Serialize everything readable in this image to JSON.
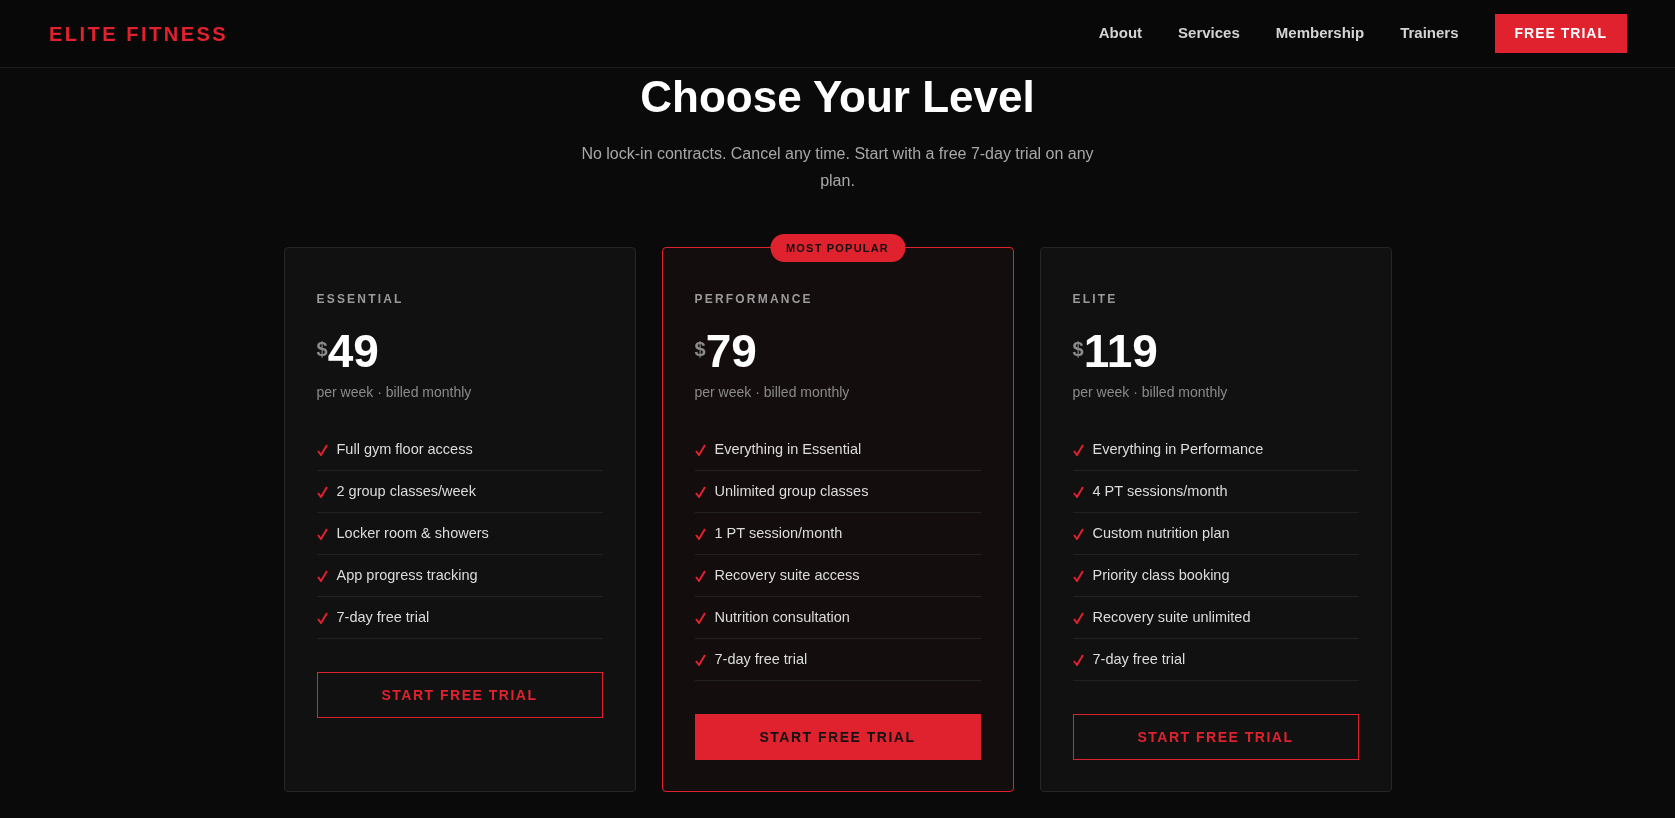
{
  "header": {
    "logo": "ELITE FITNESS",
    "nav": [
      "About",
      "Services",
      "Membership",
      "Trainers"
    ],
    "cta": "FREE TRIAL"
  },
  "hero": {
    "title": "Choose Your Level",
    "subtitle": "No lock-in contracts. Cancel any time. Start with a free 7-day trial on any plan."
  },
  "plans": [
    {
      "name": "ESSENTIAL",
      "currency": "$",
      "price": "49",
      "period": "per week · billed monthly",
      "featured": false,
      "features": [
        "Full gym floor access",
        "2 group classes/week",
        "Locker room & showers",
        "App progress tracking",
        "7-day free trial"
      ],
      "button": "START FREE TRIAL"
    },
    {
      "name": "PERFORMANCE",
      "badge": "MOST POPULAR",
      "currency": "$",
      "price": "79",
      "period": "per week · billed monthly",
      "featured": true,
      "features": [
        "Everything in Essential",
        "Unlimited group classes",
        "1 PT session/month",
        "Recovery suite access",
        "Nutrition consultation",
        "7-day free trial"
      ],
      "button": "START FREE TRIAL"
    },
    {
      "name": "ELITE",
      "currency": "$",
      "price": "119",
      "period": "per week · billed monthly",
      "featured": false,
      "features": [
        "Everything in Performance",
        "4 PT sessions/month",
        "Custom nutrition plan",
        "Priority class booking",
        "Recovery suite unlimited",
        "7-day free trial"
      ],
      "button": "START FREE TRIAL"
    }
  ]
}
